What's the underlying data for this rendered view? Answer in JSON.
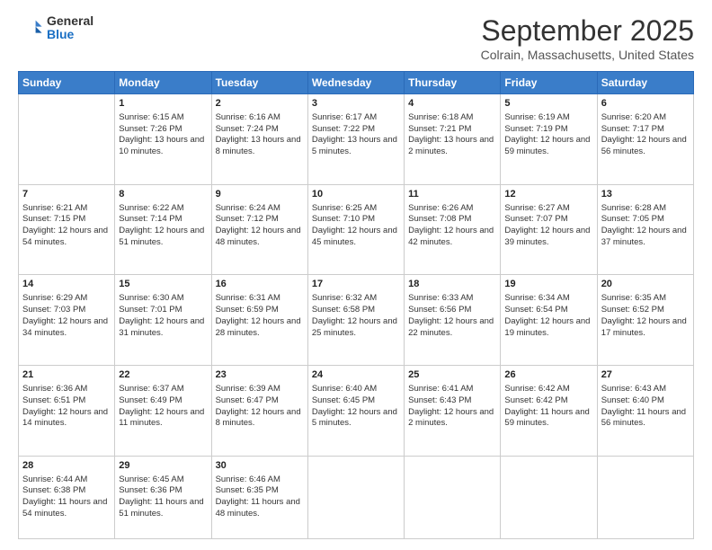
{
  "header": {
    "logo_general": "General",
    "logo_blue": "Blue",
    "month_title": "September 2025",
    "location": "Colrain, Massachusetts, United States"
  },
  "days_of_week": [
    "Sunday",
    "Monday",
    "Tuesday",
    "Wednesday",
    "Thursday",
    "Friday",
    "Saturday"
  ],
  "weeks": [
    [
      {
        "day": "",
        "sunrise": "",
        "sunset": "",
        "daylight": ""
      },
      {
        "day": "1",
        "sunrise": "Sunrise: 6:15 AM",
        "sunset": "Sunset: 7:26 PM",
        "daylight": "Daylight: 13 hours and 10 minutes."
      },
      {
        "day": "2",
        "sunrise": "Sunrise: 6:16 AM",
        "sunset": "Sunset: 7:24 PM",
        "daylight": "Daylight: 13 hours and 8 minutes."
      },
      {
        "day": "3",
        "sunrise": "Sunrise: 6:17 AM",
        "sunset": "Sunset: 7:22 PM",
        "daylight": "Daylight: 13 hours and 5 minutes."
      },
      {
        "day": "4",
        "sunrise": "Sunrise: 6:18 AM",
        "sunset": "Sunset: 7:21 PM",
        "daylight": "Daylight: 13 hours and 2 minutes."
      },
      {
        "day": "5",
        "sunrise": "Sunrise: 6:19 AM",
        "sunset": "Sunset: 7:19 PM",
        "daylight": "Daylight: 12 hours and 59 minutes."
      },
      {
        "day": "6",
        "sunrise": "Sunrise: 6:20 AM",
        "sunset": "Sunset: 7:17 PM",
        "daylight": "Daylight: 12 hours and 56 minutes."
      }
    ],
    [
      {
        "day": "7",
        "sunrise": "Sunrise: 6:21 AM",
        "sunset": "Sunset: 7:15 PM",
        "daylight": "Daylight: 12 hours and 54 minutes."
      },
      {
        "day": "8",
        "sunrise": "Sunrise: 6:22 AM",
        "sunset": "Sunset: 7:14 PM",
        "daylight": "Daylight: 12 hours and 51 minutes."
      },
      {
        "day": "9",
        "sunrise": "Sunrise: 6:24 AM",
        "sunset": "Sunset: 7:12 PM",
        "daylight": "Daylight: 12 hours and 48 minutes."
      },
      {
        "day": "10",
        "sunrise": "Sunrise: 6:25 AM",
        "sunset": "Sunset: 7:10 PM",
        "daylight": "Daylight: 12 hours and 45 minutes."
      },
      {
        "day": "11",
        "sunrise": "Sunrise: 6:26 AM",
        "sunset": "Sunset: 7:08 PM",
        "daylight": "Daylight: 12 hours and 42 minutes."
      },
      {
        "day": "12",
        "sunrise": "Sunrise: 6:27 AM",
        "sunset": "Sunset: 7:07 PM",
        "daylight": "Daylight: 12 hours and 39 minutes."
      },
      {
        "day": "13",
        "sunrise": "Sunrise: 6:28 AM",
        "sunset": "Sunset: 7:05 PM",
        "daylight": "Daylight: 12 hours and 37 minutes."
      }
    ],
    [
      {
        "day": "14",
        "sunrise": "Sunrise: 6:29 AM",
        "sunset": "Sunset: 7:03 PM",
        "daylight": "Daylight: 12 hours and 34 minutes."
      },
      {
        "day": "15",
        "sunrise": "Sunrise: 6:30 AM",
        "sunset": "Sunset: 7:01 PM",
        "daylight": "Daylight: 12 hours and 31 minutes."
      },
      {
        "day": "16",
        "sunrise": "Sunrise: 6:31 AM",
        "sunset": "Sunset: 6:59 PM",
        "daylight": "Daylight: 12 hours and 28 minutes."
      },
      {
        "day": "17",
        "sunrise": "Sunrise: 6:32 AM",
        "sunset": "Sunset: 6:58 PM",
        "daylight": "Daylight: 12 hours and 25 minutes."
      },
      {
        "day": "18",
        "sunrise": "Sunrise: 6:33 AM",
        "sunset": "Sunset: 6:56 PM",
        "daylight": "Daylight: 12 hours and 22 minutes."
      },
      {
        "day": "19",
        "sunrise": "Sunrise: 6:34 AM",
        "sunset": "Sunset: 6:54 PM",
        "daylight": "Daylight: 12 hours and 19 minutes."
      },
      {
        "day": "20",
        "sunrise": "Sunrise: 6:35 AM",
        "sunset": "Sunset: 6:52 PM",
        "daylight": "Daylight: 12 hours and 17 minutes."
      }
    ],
    [
      {
        "day": "21",
        "sunrise": "Sunrise: 6:36 AM",
        "sunset": "Sunset: 6:51 PM",
        "daylight": "Daylight: 12 hours and 14 minutes."
      },
      {
        "day": "22",
        "sunrise": "Sunrise: 6:37 AM",
        "sunset": "Sunset: 6:49 PM",
        "daylight": "Daylight: 12 hours and 11 minutes."
      },
      {
        "day": "23",
        "sunrise": "Sunrise: 6:39 AM",
        "sunset": "Sunset: 6:47 PM",
        "daylight": "Daylight: 12 hours and 8 minutes."
      },
      {
        "day": "24",
        "sunrise": "Sunrise: 6:40 AM",
        "sunset": "Sunset: 6:45 PM",
        "daylight": "Daylight: 12 hours and 5 minutes."
      },
      {
        "day": "25",
        "sunrise": "Sunrise: 6:41 AM",
        "sunset": "Sunset: 6:43 PM",
        "daylight": "Daylight: 12 hours and 2 minutes."
      },
      {
        "day": "26",
        "sunrise": "Sunrise: 6:42 AM",
        "sunset": "Sunset: 6:42 PM",
        "daylight": "Daylight: 11 hours and 59 minutes."
      },
      {
        "day": "27",
        "sunrise": "Sunrise: 6:43 AM",
        "sunset": "Sunset: 6:40 PM",
        "daylight": "Daylight: 11 hours and 56 minutes."
      }
    ],
    [
      {
        "day": "28",
        "sunrise": "Sunrise: 6:44 AM",
        "sunset": "Sunset: 6:38 PM",
        "daylight": "Daylight: 11 hours and 54 minutes."
      },
      {
        "day": "29",
        "sunrise": "Sunrise: 6:45 AM",
        "sunset": "Sunset: 6:36 PM",
        "daylight": "Daylight: 11 hours and 51 minutes."
      },
      {
        "day": "30",
        "sunrise": "Sunrise: 6:46 AM",
        "sunset": "Sunset: 6:35 PM",
        "daylight": "Daylight: 11 hours and 48 minutes."
      },
      {
        "day": "",
        "sunrise": "",
        "sunset": "",
        "daylight": ""
      },
      {
        "day": "",
        "sunrise": "",
        "sunset": "",
        "daylight": ""
      },
      {
        "day": "",
        "sunrise": "",
        "sunset": "",
        "daylight": ""
      },
      {
        "day": "",
        "sunrise": "",
        "sunset": "",
        "daylight": ""
      }
    ]
  ]
}
